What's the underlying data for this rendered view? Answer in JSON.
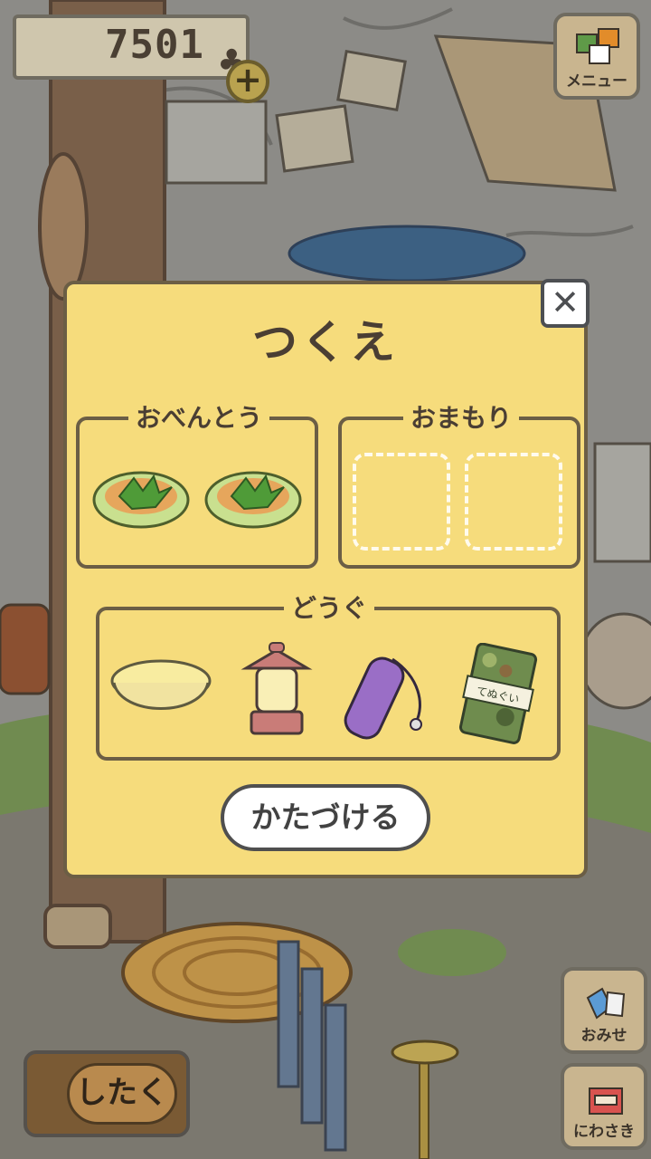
{
  "hud": {
    "clover_count": "7501",
    "clover_symbol": "♣",
    "add_symbol": "+"
  },
  "menu_button": {
    "label": "メニュー"
  },
  "shop_button": {
    "label": "おみせ"
  },
  "garden_button": {
    "label": "にわさき"
  },
  "prepare_button": {
    "label": "したく"
  },
  "panel": {
    "title": "つくえ",
    "close_symbol": "✕",
    "lunch_group": {
      "label": "おべんとう"
    },
    "charm_group": {
      "label": "おまもり"
    },
    "tools_group": {
      "label": "どうぐ"
    },
    "tidy_button": {
      "label": "かたづける"
    },
    "tool_towel_text": "てぬぐい"
  },
  "colors": {
    "panel_bg": "#f6dc7c",
    "panel_border": "#6b5e45",
    "button_bg": "#ffffff"
  }
}
